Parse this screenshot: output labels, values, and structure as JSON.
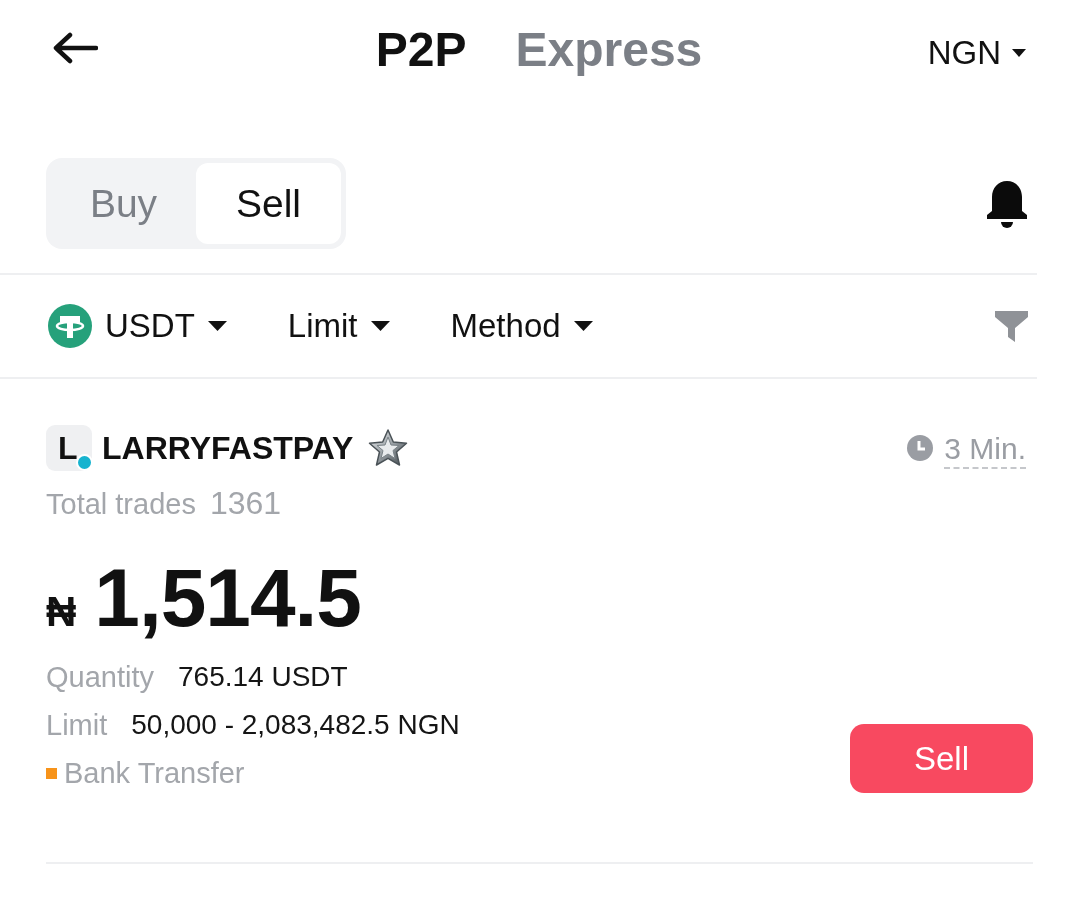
{
  "header": {
    "tabs": [
      {
        "label": "P2P",
        "selected": true
      },
      {
        "label": "Express",
        "selected": false
      }
    ],
    "currency": "NGN"
  },
  "trade_side": [
    {
      "label": "Buy",
      "selected": false
    },
    {
      "label": "Sell",
      "selected": true
    }
  ],
  "filters": [
    {
      "kind": "coin",
      "label": "USDT"
    },
    {
      "kind": "dropdown",
      "label": "Limit"
    },
    {
      "kind": "dropdown",
      "label": "Method"
    }
  ],
  "offer": {
    "avatar_letter": "L",
    "online": true,
    "merchant": "LARRYFASTPAY",
    "payment_time": "3 Min.",
    "total_trades_label": "Total trades",
    "total_trades": "1361",
    "currency_symbol": "₦",
    "price": "1,514.5",
    "details": [
      {
        "label": "Quantity",
        "value": "765.14 USDT"
      },
      {
        "label": "Limit",
        "value": "50,000 - 2,083,482.5 NGN"
      }
    ],
    "payment_methods": [
      {
        "name": "Bank Transfer",
        "color": "#f7931a"
      }
    ],
    "action": "Sell"
  }
}
